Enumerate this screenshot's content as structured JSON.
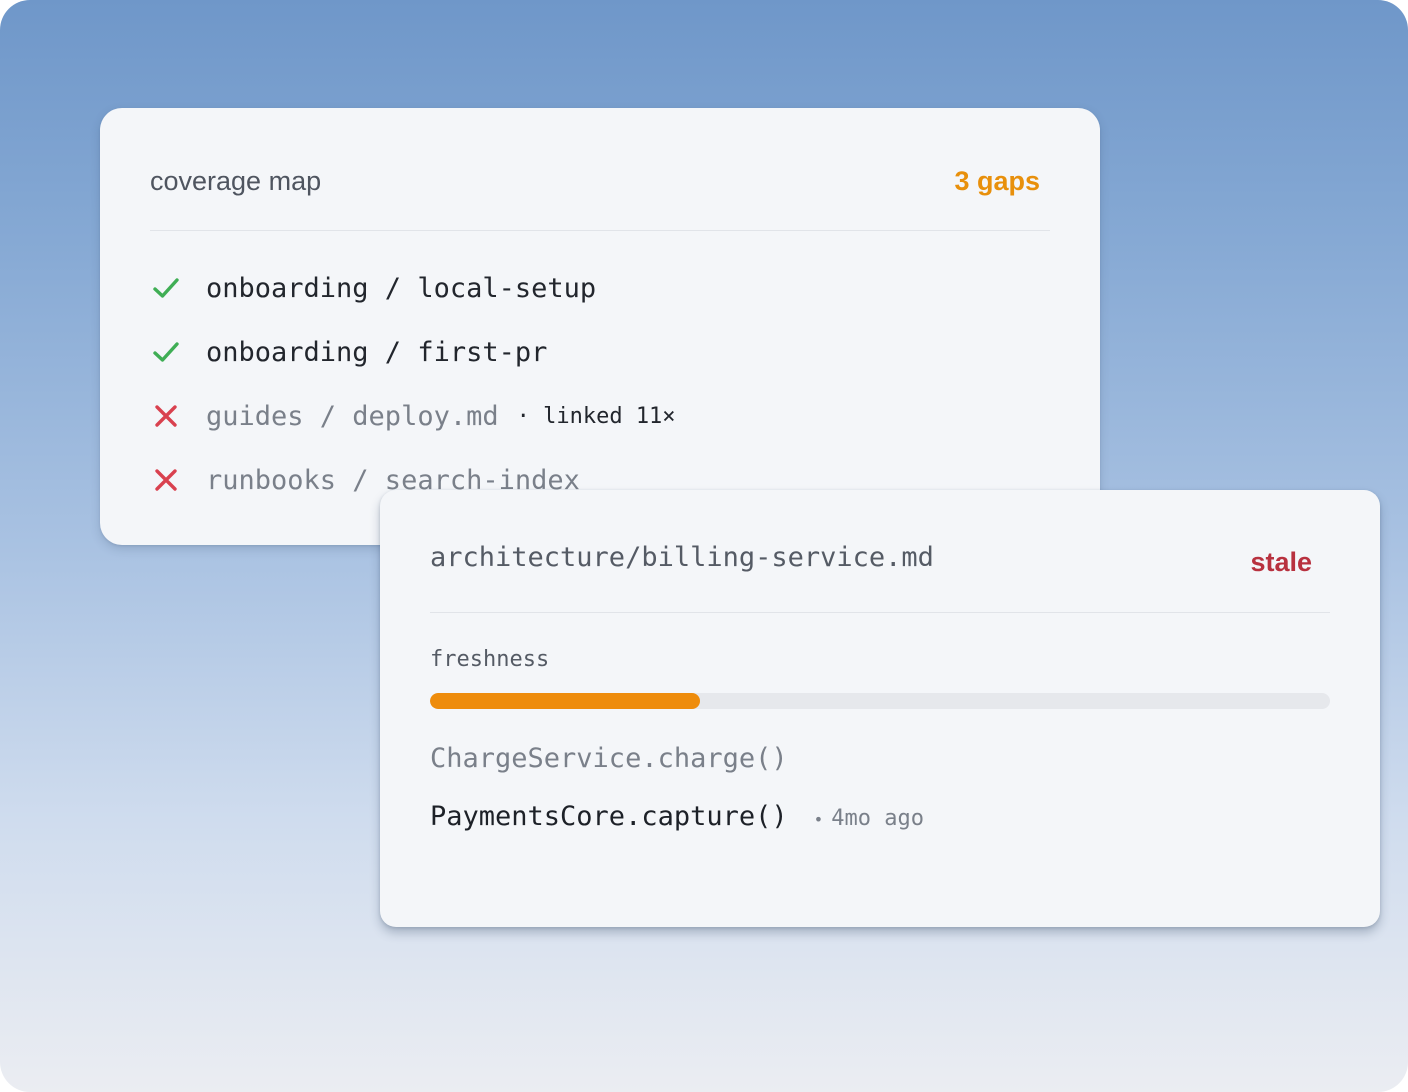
{
  "coverage": {
    "title": "coverage map",
    "gaps_label": "3 gaps",
    "gaps_color": "#e8900c",
    "items": [
      {
        "path": "onboarding / local-setup",
        "status": "covered",
        "icon": "check-icon",
        "extra": ""
      },
      {
        "path": "onboarding / first-pr",
        "status": "covered",
        "icon": "check-icon",
        "extra": ""
      },
      {
        "path": "guides / deploy.md",
        "status": "missing",
        "icon": "cross-icon",
        "extra": "· linked 11×"
      },
      {
        "path": "runbooks / search-index",
        "status": "missing",
        "icon": "cross-icon",
        "extra": ""
      }
    ]
  },
  "doc": {
    "path": "architecture/billing-service.md",
    "status_label": "stale",
    "status_color": "#b8313f",
    "freshness_label": "freshness",
    "freshness_fraction": 0.3,
    "freshness_color": "#ee8c0c",
    "old_symbol": "ChargeService.charge()",
    "new_symbol": "PaymentsCore.capture()",
    "age_dot": "•",
    "age": "4mo ago"
  },
  "colors": {
    "check": "#3fae55",
    "cross": "#d9414f"
  }
}
